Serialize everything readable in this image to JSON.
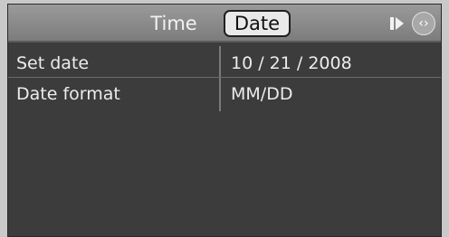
{
  "header": {
    "tabs": [
      {
        "label": "Time",
        "active": false
      },
      {
        "label": "Date",
        "active": true
      }
    ],
    "icons": [
      "play-next-icon",
      "controller-dial-icon"
    ],
    "dial_glyph": "‹›"
  },
  "settings": [
    {
      "label": "Set date",
      "value": "10 / 21 / 2008"
    },
    {
      "label": "Date format",
      "value": "MM/DD"
    }
  ],
  "colors": {
    "header": "#8a8a8a",
    "panel": "#3c3c3c",
    "text": "#ececec",
    "selected_tab_bg": "#e9e9e9"
  }
}
